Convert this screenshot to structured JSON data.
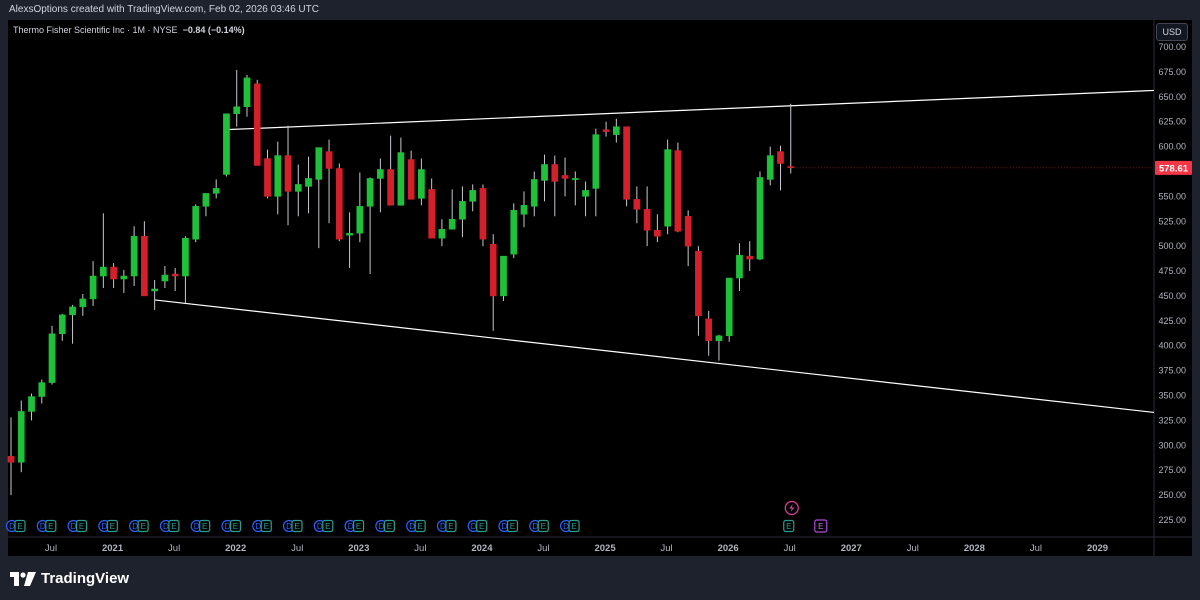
{
  "header": {
    "attribution": "AlexsOptions created with TradingView.com, Feb 02, 2026 03:46 UTC"
  },
  "legend": {
    "symbol": "Thermo Fisher Scientific Inc · 1M · NYSE",
    "change": "−0.84 (−0.14%)"
  },
  "currency_button": "USD",
  "footer": {
    "brand": "TradingView"
  },
  "colors": {
    "up": "#26a69a",
    "up_body": "#1fc03a",
    "down": "#d3202a",
    "background": "#000000",
    "axis_text": "#b2b5be",
    "trendline": "#ffffff",
    "price_label_bg": "#f23645",
    "earnings_badge": "#2962ff",
    "dividend_badge": "#2a9d8f"
  },
  "chart_data": {
    "type": "candlestick",
    "title": "Thermo Fisher Scientific Inc",
    "interval": "1M",
    "exchange": "NYSE",
    "last_price": "578.61",
    "y_axis": {
      "ticks": [
        225,
        250,
        275,
        300,
        325,
        350,
        375,
        400,
        425,
        450,
        475,
        500,
        525,
        550,
        575,
        600,
        625,
        650,
        675,
        700
      ],
      "tick_labels": [
        "225.00",
        "250.00",
        "275.00",
        "300.00",
        "325.00",
        "350.00",
        "375.00",
        "400.00",
        "425.00",
        "450.00",
        "475.00",
        "500.00",
        "525.00",
        "550.00",
        "575.00",
        "600.00",
        "625.00",
        "650.00",
        "675.00",
        "700.00"
      ],
      "range": [
        212,
        706
      ]
    },
    "x_axis": {
      "tick_labels": [
        "Jul",
        "2021",
        "Jul",
        "2022",
        "Jul",
        "2023",
        "Jul",
        "2024",
        "Jul",
        "2025",
        "Jul",
        "2026",
        "Jul",
        "2027",
        "Jul",
        "2028",
        "Jul",
        "2029"
      ],
      "tick_index": [
        0,
        6,
        12,
        18,
        24,
        30,
        36,
        42,
        48,
        54,
        60,
        66,
        72,
        78,
        84,
        90,
        96,
        102
      ],
      "first_index": 0,
      "start_label": "2020-07"
    },
    "candles": [
      {
        "o": 289,
        "h": 328,
        "l": 250,
        "c": 283
      },
      {
        "o": 283,
        "h": 345,
        "l": 273,
        "c": 334
      },
      {
        "o": 334,
        "h": 352,
        "l": 325,
        "c": 349
      },
      {
        "o": 349,
        "h": 366,
        "l": 342,
        "c": 363
      },
      {
        "o": 363,
        "h": 420,
        "l": 361,
        "c": 412
      },
      {
        "o": 412,
        "h": 432,
        "l": 405,
        "c": 431
      },
      {
        "o": 431,
        "h": 441,
        "l": 402,
        "c": 439
      },
      {
        "o": 439,
        "h": 452,
        "l": 430,
        "c": 447
      },
      {
        "o": 447,
        "h": 485,
        "l": 440,
        "c": 470
      },
      {
        "o": 470,
        "h": 533,
        "l": 458,
        "c": 479
      },
      {
        "o": 479,
        "h": 483,
        "l": 458,
        "c": 467
      },
      {
        "o": 467,
        "h": 476,
        "l": 453,
        "c": 470
      },
      {
        "o": 470,
        "h": 520,
        "l": 460,
        "c": 510
      },
      {
        "o": 510,
        "h": 525,
        "l": 450,
        "c": 450
      },
      {
        "o": 455,
        "h": 466,
        "l": 436,
        "c": 457
      },
      {
        "o": 465,
        "h": 480,
        "l": 458,
        "c": 471
      },
      {
        "o": 472,
        "h": 478,
        "l": 455,
        "c": 470
      },
      {
        "o": 470,
        "h": 510,
        "l": 443,
        "c": 508
      },
      {
        "o": 507,
        "h": 542,
        "l": 504,
        "c": 540
      },
      {
        "o": 540,
        "h": 549,
        "l": 530,
        "c": 553
      },
      {
        "o": 553,
        "h": 567,
        "l": 548,
        "c": 558
      },
      {
        "o": 572,
        "h": 595,
        "l": 570,
        "c": 633
      },
      {
        "o": 633,
        "h": 677,
        "l": 620,
        "c": 640
      },
      {
        "o": 640,
        "h": 672,
        "l": 630,
        "c": 669
      },
      {
        "o": 663,
        "h": 667,
        "l": 590,
        "c": 581
      },
      {
        "o": 588,
        "h": 597,
        "l": 548,
        "c": 550
      },
      {
        "o": 550,
        "h": 605,
        "l": 532,
        "c": 591
      },
      {
        "o": 591,
        "h": 621,
        "l": 521,
        "c": 555
      },
      {
        "o": 555,
        "h": 582,
        "l": 530,
        "c": 562
      },
      {
        "o": 560,
        "h": 590,
        "l": 533,
        "c": 568
      },
      {
        "o": 567,
        "h": 590,
        "l": 498,
        "c": 599
      },
      {
        "o": 595,
        "h": 607,
        "l": 523,
        "c": 578
      },
      {
        "o": 578,
        "h": 583,
        "l": 505,
        "c": 507
      },
      {
        "o": 511,
        "h": 534,
        "l": 478,
        "c": 513
      },
      {
        "o": 513,
        "h": 574,
        "l": 504,
        "c": 540
      },
      {
        "o": 540,
        "h": 569,
        "l": 472,
        "c": 568
      },
      {
        "o": 568,
        "h": 588,
        "l": 534,
        "c": 577
      },
      {
        "o": 577,
        "h": 611,
        "l": 567,
        "c": 541
      },
      {
        "o": 541,
        "h": 609,
        "l": 546,
        "c": 594
      },
      {
        "o": 587,
        "h": 596,
        "l": 565,
        "c": 547
      },
      {
        "o": 548,
        "h": 588,
        "l": 541,
        "c": 577
      },
      {
        "o": 557,
        "h": 568,
        "l": 524,
        "c": 508
      },
      {
        "o": 508,
        "h": 527,
        "l": 500,
        "c": 517
      },
      {
        "o": 517,
        "h": 557,
        "l": 519,
        "c": 527
      },
      {
        "o": 527,
        "h": 560,
        "l": 509,
        "c": 545
      },
      {
        "o": 545,
        "h": 562,
        "l": 535,
        "c": 556
      },
      {
        "o": 558,
        "h": 562,
        "l": 500,
        "c": 507
      },
      {
        "o": 502,
        "h": 512,
        "l": 415,
        "c": 450
      },
      {
        "o": 450,
        "h": 483,
        "l": 445,
        "c": 490
      },
      {
        "o": 492,
        "h": 543,
        "l": 488,
        "c": 536
      },
      {
        "o": 532,
        "h": 555,
        "l": 519,
        "c": 541
      },
      {
        "o": 540,
        "h": 575,
        "l": 530,
        "c": 567
      },
      {
        "o": 566,
        "h": 592,
        "l": 545,
        "c": 582
      },
      {
        "o": 582,
        "h": 591,
        "l": 530,
        "c": 565
      },
      {
        "o": 571,
        "h": 589,
        "l": 550,
        "c": 568
      },
      {
        "o": 568,
        "h": 575,
        "l": 541,
        "c": 568
      },
      {
        "o": 550,
        "h": 565,
        "l": 530,
        "c": 556
      },
      {
        "o": 558,
        "h": 618,
        "l": 530,
        "c": 612
      },
      {
        "o": 617,
        "h": 625,
        "l": 610,
        "c": 615
      },
      {
        "o": 612,
        "h": 628,
        "l": 604,
        "c": 620
      },
      {
        "o": 620,
        "h": 618,
        "l": 540,
        "c": 547
      },
      {
        "o": 547,
        "h": 560,
        "l": 523,
        "c": 537
      },
      {
        "o": 537,
        "h": 560,
        "l": 500,
        "c": 516
      },
      {
        "o": 516,
        "h": 532,
        "l": 504,
        "c": 510
      },
      {
        "o": 520,
        "h": 607,
        "l": 512,
        "c": 597
      },
      {
        "o": 596,
        "h": 604,
        "l": 514,
        "c": 515
      },
      {
        "o": 530,
        "h": 536,
        "l": 480,
        "c": 500
      },
      {
        "o": 495,
        "h": 500,
        "l": 410,
        "c": 430
      },
      {
        "o": 427,
        "h": 435,
        "l": 390,
        "c": 405
      },
      {
        "o": 405,
        "h": 411,
        "l": 385,
        "c": 410
      },
      {
        "o": 410,
        "h": 468,
        "l": 404,
        "c": 468
      },
      {
        "o": 468,
        "h": 503,
        "l": 455,
        "c": 491
      },
      {
        "o": 490,
        "h": 505,
        "l": 475,
        "c": 487
      },
      {
        "o": 487,
        "h": 575,
        "l": 486,
        "c": 569
      },
      {
        "o": 567,
        "h": 600,
        "l": 561,
        "c": 591
      },
      {
        "o": 595,
        "h": 601,
        "l": 556,
        "c": 583
      },
      {
        "o": 580,
        "h": 643,
        "l": 573,
        "c": 579
      }
    ],
    "trendlines": [
      {
        "from": {
          "i": 21,
          "p": 617
        },
        "to": {
          "i": 114,
          "p": 657.5
        }
      },
      {
        "from": {
          "i": 14,
          "p": 446
        },
        "to": {
          "i": 114,
          "p": 330
        }
      }
    ],
    "events": {
      "labels": [
        "D",
        "E",
        "D",
        "E",
        "D",
        "E",
        "D",
        "E",
        "D",
        "E",
        "D",
        "E",
        "D",
        "E",
        "D",
        "E",
        "D",
        "E",
        "D",
        "E",
        "D",
        "E",
        "D",
        "E",
        "D",
        "E",
        "D",
        "E",
        "D",
        "E",
        "D",
        "E",
        "D",
        "E",
        "D",
        "E",
        "D",
        "E",
        "E"
      ],
      "future_label": "E"
    }
  }
}
